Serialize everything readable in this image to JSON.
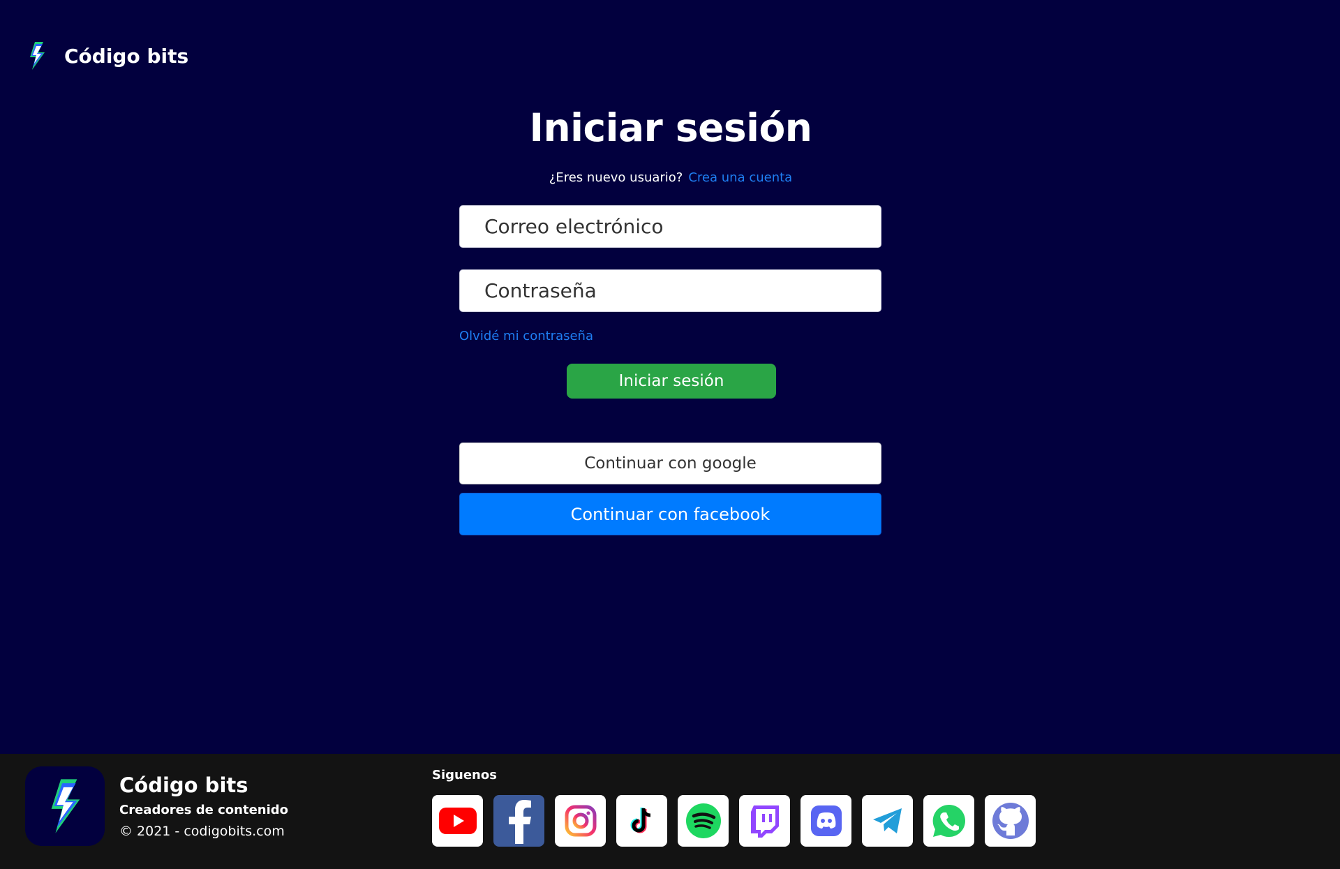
{
  "navbar": {
    "brand": "Código bits"
  },
  "login": {
    "title": "Iniciar sesión",
    "new_user_text": "¿Eres nuevo usuario?",
    "create_account": "Crea una cuenta",
    "email_placeholder": "Correo electrónico",
    "password_placeholder": "Contraseña",
    "forgot": "Olvidé mi contraseña",
    "submit": "Iniciar sesión",
    "google": "Continuar con google",
    "facebook": "Continuar con facebook"
  },
  "footer": {
    "brand": "Código bits",
    "tagline": "Creadores de contenido",
    "copyright": "© 2021 - codigobits.com",
    "follow": "Siguenos",
    "socials": [
      "youtube-icon",
      "facebook-icon",
      "instagram-icon",
      "tiktok-icon",
      "spotify-icon",
      "twitch-icon",
      "discord-icon",
      "telegram-icon",
      "whatsapp-icon",
      "github-icon"
    ]
  },
  "colors": {
    "background": "#02003e",
    "link": "#1f7ef2",
    "login_button": "#2aa546",
    "facebook_button": "#007bff",
    "footer": "#131313"
  }
}
